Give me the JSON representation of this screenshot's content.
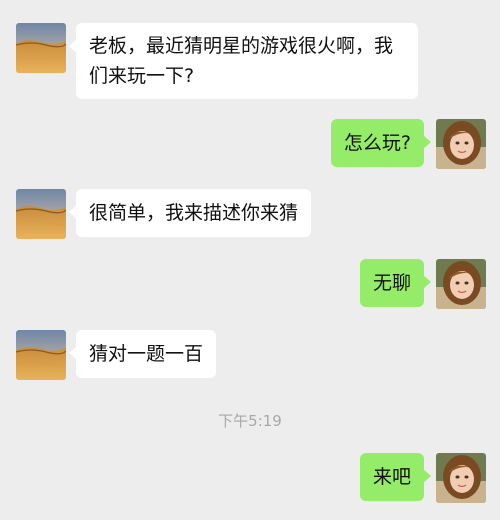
{
  "messages": [
    {
      "side": "left",
      "text": "老板，最近猜明星的游戏很火啊，我们来玩一下?"
    },
    {
      "side": "right",
      "text": "怎么玩?"
    },
    {
      "side": "left",
      "text": "很简单，我来描述你来猜"
    },
    {
      "side": "right",
      "text": "无聊"
    },
    {
      "side": "left",
      "text": "猜对一题一百"
    },
    {
      "side": "right",
      "text": "来吧"
    }
  ],
  "timestamp": "下午5:19",
  "colors": {
    "background": "#ededed",
    "incoming_bubble": "#ffffff",
    "outgoing_bubble": "#95ec69",
    "timestamp_text": "#a8a8a8"
  },
  "icons": {
    "incoming_avatar": "landscape-avatar-icon",
    "outgoing_avatar": "girl-avatar-icon"
  }
}
